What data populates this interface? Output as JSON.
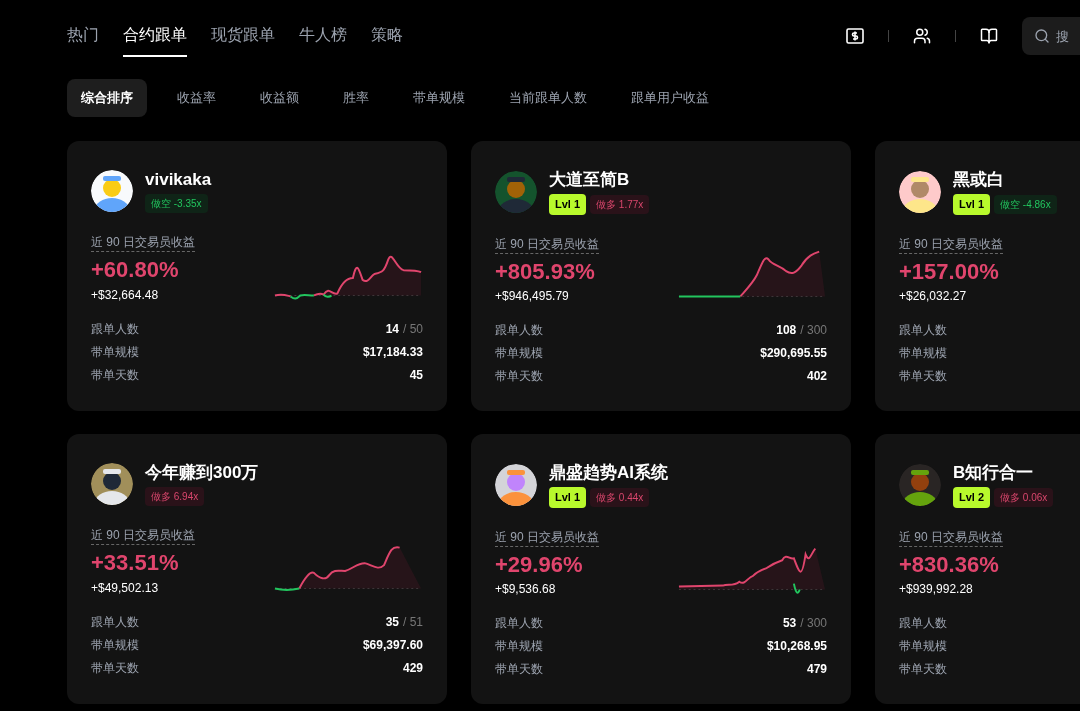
{
  "nav": {
    "tabs": [
      {
        "label": "热门",
        "selected": false
      },
      {
        "label": "合约跟单",
        "selected": true
      },
      {
        "label": "现货跟单",
        "selected": false
      },
      {
        "label": "牛人榜",
        "selected": false
      },
      {
        "label": "策略",
        "selected": false
      }
    ]
  },
  "search": {
    "placeholder": "搜"
  },
  "sort_tabs": [
    {
      "label": "综合排序",
      "selected": true
    },
    {
      "label": "收益率",
      "selected": false
    },
    {
      "label": "收益额",
      "selected": false
    },
    {
      "label": "胜率",
      "selected": false
    },
    {
      "label": "带单规模",
      "selected": false
    },
    {
      "label": "当前跟单人数",
      "selected": false
    },
    {
      "label": "跟单用户收益",
      "selected": false
    }
  ],
  "cards": [
    {
      "name": "vivikaka",
      "direction": {
        "kind": "short",
        "text": "做空 -3.35x"
      },
      "metric_label": "近 90 日交易员收益",
      "return_pct": "+60.80%",
      "return_usd": "+$32,664.48",
      "sparkline": true,
      "stats": [
        {
          "label": "跟单人数",
          "value": "14",
          "limit": "/ 50"
        },
        {
          "label": "带单规模",
          "value": "$17,184.33"
        },
        {
          "label": "带单天数",
          "value": "45"
        }
      ]
    },
    {
      "name": "大道至简B",
      "level": "Lvl 1",
      "direction": {
        "kind": "long",
        "text": "做多 1.77x"
      },
      "metric_label": "近 90 日交易员收益",
      "return_pct": "+805.93%",
      "return_usd": "+$946,495.79",
      "sparkline": true,
      "stats": [
        {
          "label": "跟单人数",
          "value": "108",
          "limit": "/ 300"
        },
        {
          "label": "带单规模",
          "value": "$290,695.55"
        },
        {
          "label": "带单天数",
          "value": "402"
        }
      ]
    },
    {
      "name": "黑或白",
      "level": "Lvl 1",
      "direction": {
        "kind": "short",
        "text": "做空 -4.86x"
      },
      "metric_label": "近 90 日交易员收益",
      "return_pct": "+157.00%",
      "return_usd": "+$26,032.27",
      "stats": [
        {
          "label": "跟单人数"
        },
        {
          "label": "带单规模"
        },
        {
          "label": "带单天数"
        }
      ]
    },
    {
      "name": "今年赚到300万",
      "direction": {
        "kind": "long",
        "text": "做多 6.94x"
      },
      "metric_label": "近 90 日交易员收益",
      "return_pct": "+33.51%",
      "return_usd": "+$49,502.13",
      "sparkline": true,
      "stats": [
        {
          "label": "跟单人数",
          "value": "35",
          "limit": "/ 51"
        },
        {
          "label": "带单规模",
          "value": "$69,397.60"
        },
        {
          "label": "带单天数",
          "value": "429"
        }
      ]
    },
    {
      "name": "鼎盛趋势AI系统",
      "level": "Lvl 1",
      "direction": {
        "kind": "long",
        "text": "做多 0.44x"
      },
      "metric_label": "近 90 日交易员收益",
      "return_pct": "+29.96%",
      "return_usd": "+$9,536.68",
      "sparkline": true,
      "stats": [
        {
          "label": "跟单人数",
          "value": "53",
          "limit": "/ 300"
        },
        {
          "label": "带单规模",
          "value": "$10,268.95"
        },
        {
          "label": "带单天数",
          "value": "479"
        }
      ]
    },
    {
      "name": "B知行合一",
      "level": "Lvl 2",
      "direction": {
        "kind": "long",
        "text": "做多 0.06x"
      },
      "metric_label": "近 90 日交易员收益",
      "return_pct": "+830.36%",
      "return_usd": "+$939,992.28",
      "stats": [
        {
          "label": "跟单人数"
        },
        {
          "label": "带单规模"
        },
        {
          "label": "带单天数"
        }
      ]
    }
  ]
}
